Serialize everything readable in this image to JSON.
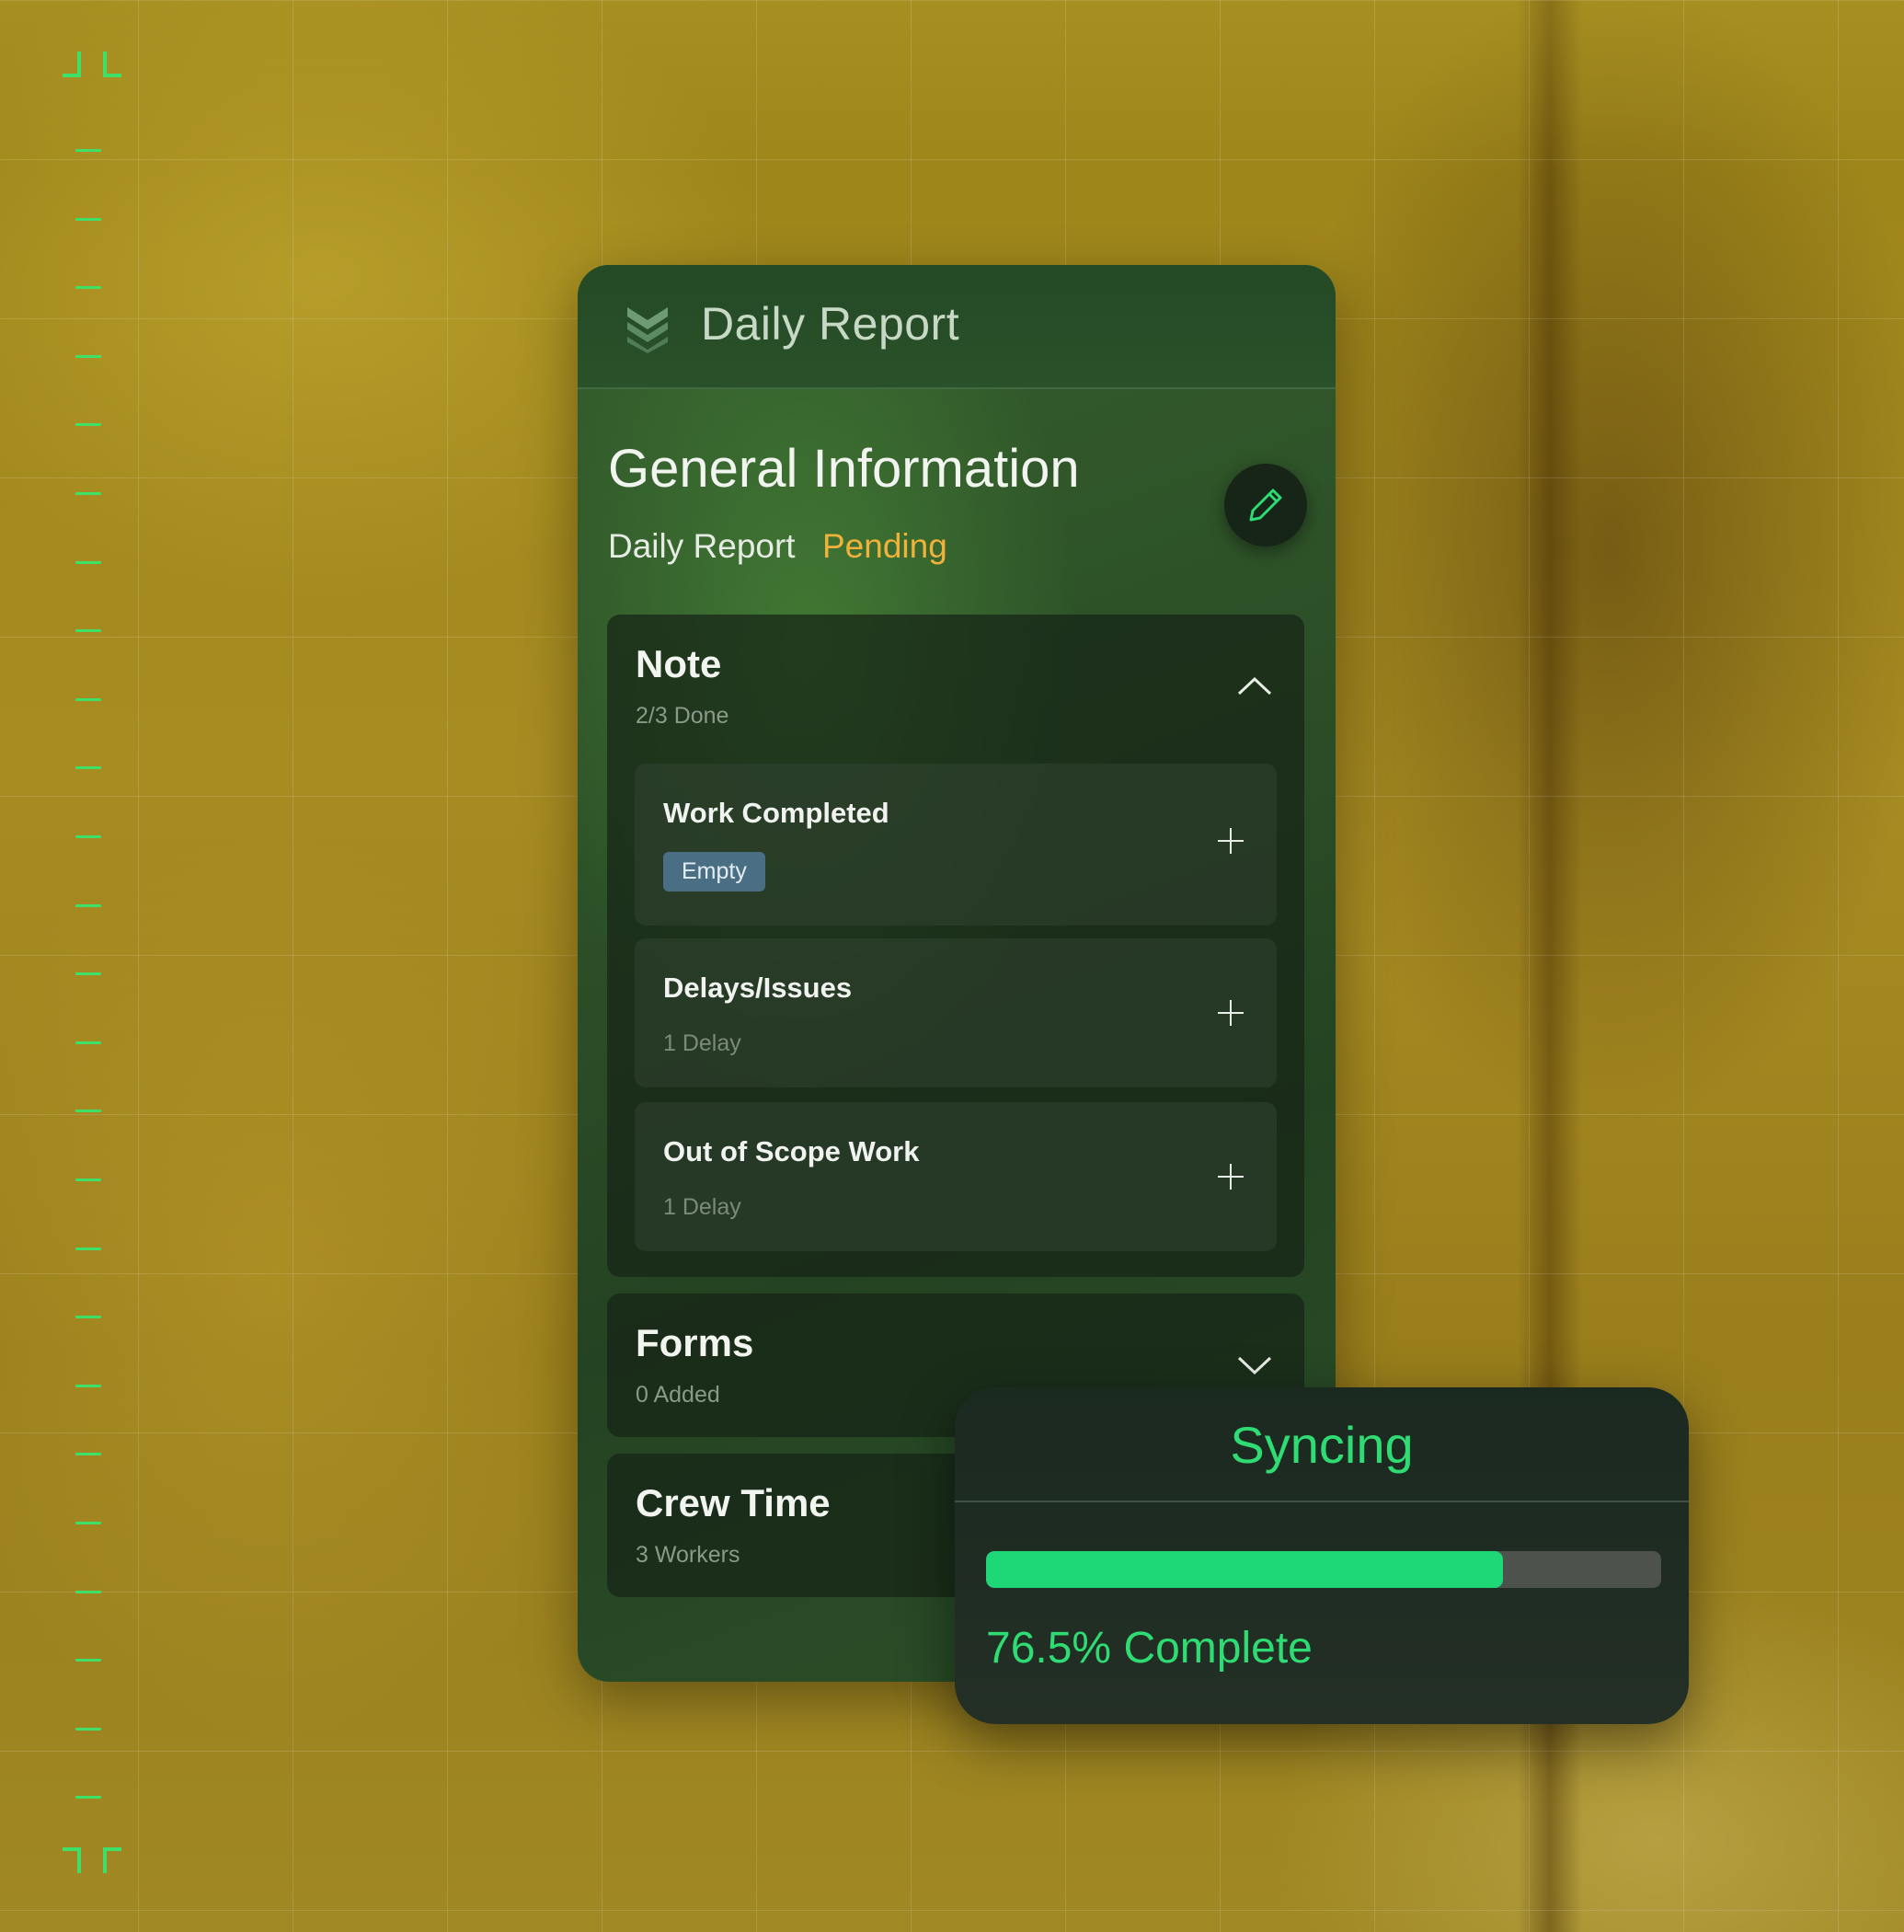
{
  "header": {
    "title": "Daily Report",
    "logo_icon": "layers-chevron-icon"
  },
  "general": {
    "title": "General Information",
    "status_label": "Daily Report",
    "status_value": "Pending",
    "edit_icon": "pencil-icon"
  },
  "note": {
    "title": "Note",
    "subtitle": "2/3 Done",
    "expanded": true,
    "items": [
      {
        "title": "Work Completed",
        "badge": "Empty"
      },
      {
        "title": "Delays/Issues",
        "subtitle": "1 Delay"
      },
      {
        "title": "Out of Scope Work",
        "subtitle": "1 Delay"
      }
    ]
  },
  "forms": {
    "title": "Forms",
    "subtitle": "0 Added",
    "expanded": false
  },
  "crew": {
    "title": "Crew Time",
    "subtitle": "3 Workers"
  },
  "sync": {
    "title": "Syncing",
    "progress": 0.765,
    "progress_text": "76.5% Complete"
  },
  "colors": {
    "accent_green": "#2fdc73",
    "progress_fill": "#1ed878",
    "pending": "#f0b23a",
    "badge_bg": "#4a6e83"
  }
}
